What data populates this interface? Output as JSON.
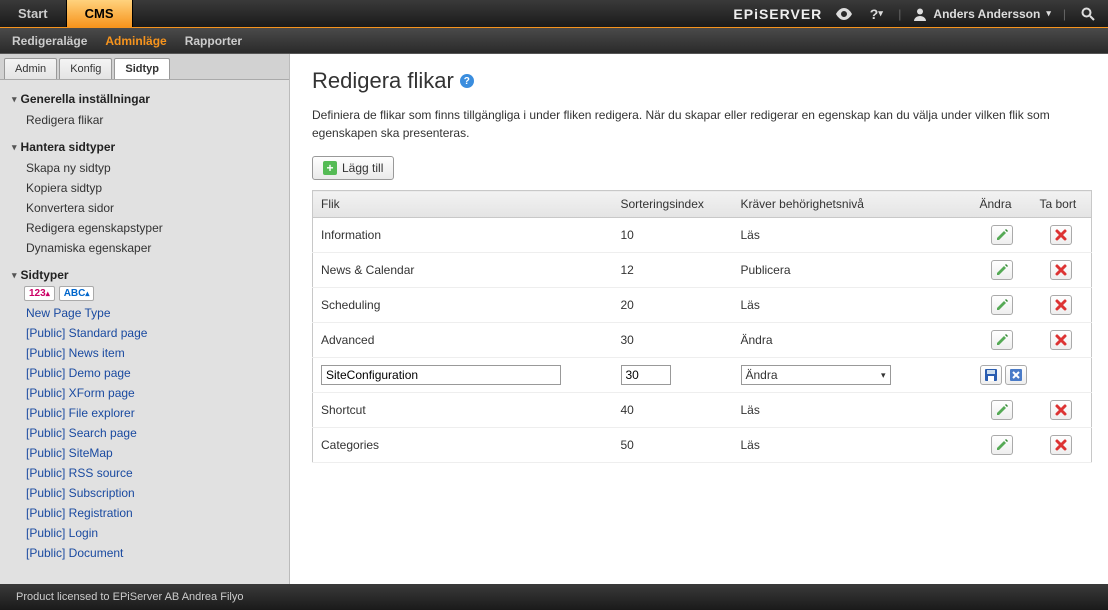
{
  "top": {
    "tabs": [
      "Start",
      "CMS"
    ],
    "active": "CMS",
    "brand": "EPiSERVER",
    "user": "Anders Andersson"
  },
  "secondbar": {
    "items": [
      "Redigeraläge",
      "Adminläge",
      "Rapporter"
    ],
    "active": "Adminläge"
  },
  "sidebar": {
    "tabs": [
      "Admin",
      "Konfig",
      "Sidtyp"
    ],
    "active": "Sidtyp",
    "groups": [
      {
        "title": "Generella inställningar",
        "items": [
          "Redigera flikar"
        ],
        "active_item": "Redigera flikar"
      },
      {
        "title": "Hantera sidtyper",
        "items": [
          "Skapa ny sidtyp",
          "Kopiera sidtyp",
          "Konvertera sidor",
          "Redigera egenskapstyper",
          "Dynamiska egenskaper"
        ]
      },
      {
        "title": "Sidtyper",
        "sort_pills": [
          "123",
          "ABC"
        ],
        "items": [
          "New Page Type",
          "[Public] Standard page",
          "[Public] News item",
          "[Public] Demo page",
          "[Public] XForm page",
          "[Public] File explorer",
          "[Public] Search page",
          "[Public] SiteMap",
          "[Public] RSS source",
          "[Public] Subscription",
          "[Public] Registration",
          "[Public] Login",
          "[Public] Document"
        ]
      }
    ]
  },
  "page": {
    "title": "Redigera flikar",
    "description": "Definiera de flikar som finns tillgängliga i under fliken redigera. När du skapar eller redigerar en egenskap kan du välja under vilken flik som egenskapen ska presenteras.",
    "add_label": "Lägg till",
    "columns": {
      "tab": "Flik",
      "sort": "Sorteringsindex",
      "perm": "Kräver behörighetsnivå",
      "edit": "Ändra",
      "del": "Ta bort"
    },
    "rows": [
      {
        "tab": "Information",
        "sort": "10",
        "perm": "Läs",
        "mode": "view"
      },
      {
        "tab": "News & Calendar",
        "sort": "12",
        "perm": "Publicera",
        "mode": "view"
      },
      {
        "tab": "Scheduling",
        "sort": "20",
        "perm": "Läs",
        "mode": "view"
      },
      {
        "tab": "Advanced",
        "sort": "30",
        "perm": "Ändra",
        "mode": "view"
      },
      {
        "tab": "SiteConfiguration",
        "sort": "30",
        "perm": "Ändra",
        "mode": "edit"
      },
      {
        "tab": "Shortcut",
        "sort": "40",
        "perm": "Läs",
        "mode": "view"
      },
      {
        "tab": "Categories",
        "sort": "50",
        "perm": "Läs",
        "mode": "view"
      }
    ]
  },
  "footer": "Product licensed to EPiServer AB Andrea Filyo"
}
